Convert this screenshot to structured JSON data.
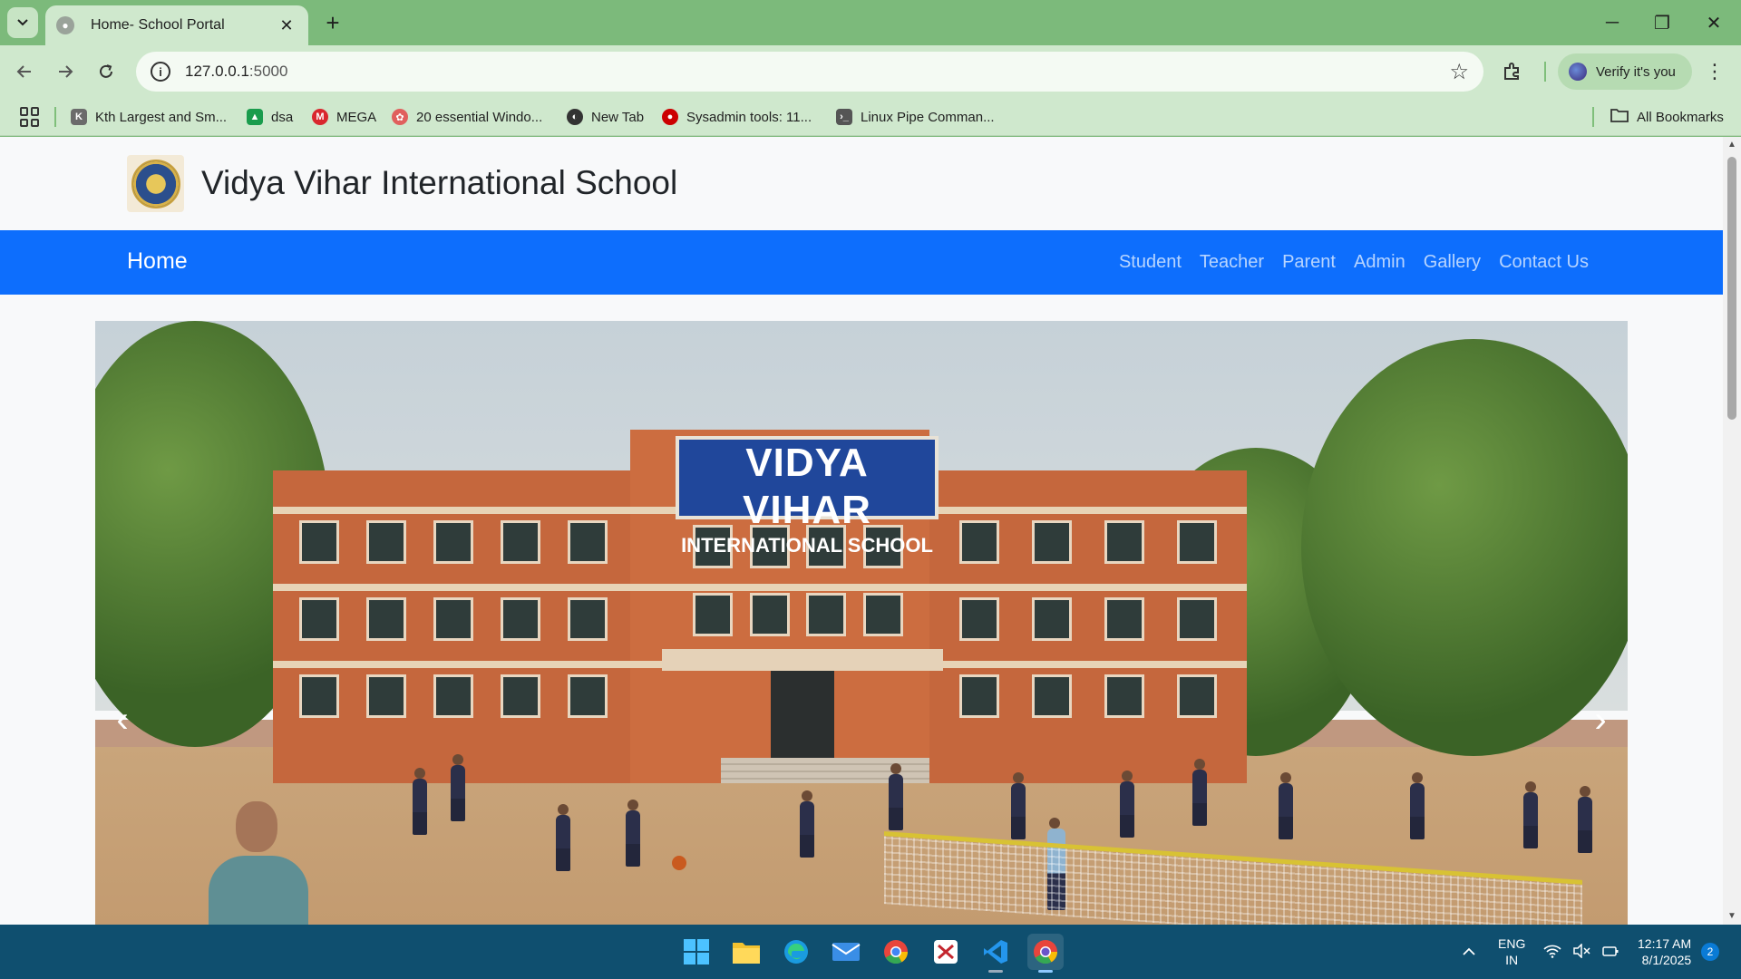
{
  "browser": {
    "tab": {
      "title": "Home- School Portal",
      "close_glyph": "✕"
    },
    "new_tab_glyph": "+",
    "window_controls": [
      "─",
      "❐",
      "✕"
    ],
    "address": {
      "host": "127.0.0.1",
      "port": ":5000"
    },
    "verify_label": "Verify it's you",
    "bookmarks": [
      {
        "label": "Kth Largest and Sm...",
        "icon": "kth-icon",
        "color": "#6b6b6b"
      },
      {
        "label": "dsa",
        "icon": "drive-icon",
        "color": "#1a9c4d"
      },
      {
        "label": "MEGA",
        "icon": "mega-icon",
        "color": "#d9272e"
      },
      {
        "label": "20 essential Windo...",
        "icon": "windows-article-icon",
        "color": "#e0605d"
      },
      {
        "label": "New Tab",
        "icon": "globe-icon",
        "color": "#333333"
      },
      {
        "label": "Sysadmin tools: 11...",
        "icon": "redhat-icon",
        "color": "#cc0000"
      },
      {
        "label": "Linux Pipe Comman...",
        "icon": "linux-icon",
        "color": "#555555"
      }
    ],
    "all_bookmarks_label": "All Bookmarks"
  },
  "site": {
    "title": "Vidya Vihar International School",
    "brand": "Home",
    "nav_links": [
      "Student",
      "Teacher",
      "Parent",
      "Admin",
      "Gallery",
      "Contact Us"
    ],
    "hero_sign": {
      "line1": "VIDYA VIHAR",
      "line2": "INTERNATIONAL SCHOOL"
    },
    "carousel": {
      "prev_glyph": "‹",
      "next_glyph": "›"
    },
    "colors": {
      "navbar": "#0d6efd",
      "header_bg": "#f8f9fa"
    }
  },
  "taskbar": {
    "apps": [
      "windows-start-icon",
      "file-explorer-icon",
      "edge-icon",
      "mail-icon",
      "chrome-icon",
      "red-app-icon",
      "vscode-icon",
      "chrome-active-icon"
    ],
    "language": {
      "line1": "ENG",
      "line2": "IN"
    },
    "clock": {
      "time": "12:17 AM",
      "date": "8/1/2025"
    },
    "notification_count": "2"
  }
}
